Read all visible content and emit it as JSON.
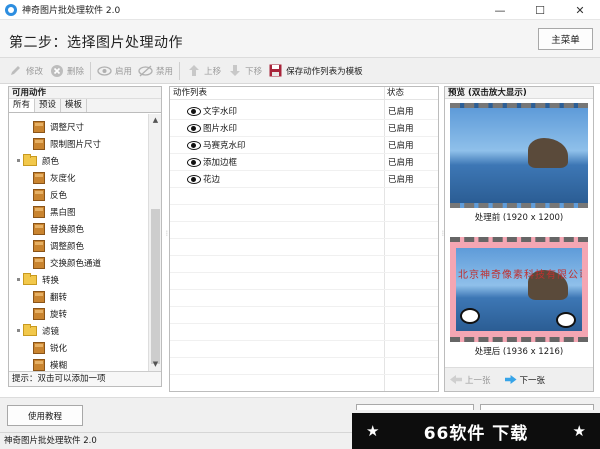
{
  "window": {
    "title": "神奇图片批处理软件 2.0"
  },
  "header": {
    "step_title": "第二步：选择图片处理动作",
    "menu_button": "主菜单"
  },
  "toolbar": {
    "modify": "修改",
    "delete": "删除",
    "enable": "启用",
    "disable": "禁用",
    "move_up": "上移",
    "move_down": "下移",
    "save_template": "保存动作列表为模板"
  },
  "left_panel": {
    "title": "可用动作",
    "tabs": [
      "所有",
      "预设",
      "模板"
    ],
    "tree": [
      {
        "label": "调整尺寸",
        "level": 2,
        "kind": "action"
      },
      {
        "label": "限制图片尺寸",
        "level": 2,
        "kind": "action"
      },
      {
        "label": "颜色",
        "level": 1,
        "kind": "folder"
      },
      {
        "label": "灰度化",
        "level": 2,
        "kind": "action"
      },
      {
        "label": "反色",
        "level": 2,
        "kind": "action"
      },
      {
        "label": "黑白图",
        "level": 2,
        "kind": "action"
      },
      {
        "label": "替换颜色",
        "level": 2,
        "kind": "action"
      },
      {
        "label": "调整颜色",
        "level": 2,
        "kind": "action"
      },
      {
        "label": "交换颜色通道",
        "level": 2,
        "kind": "action"
      },
      {
        "label": "转换",
        "level": 1,
        "kind": "folder"
      },
      {
        "label": "翻转",
        "level": 2,
        "kind": "action"
      },
      {
        "label": "旋转",
        "level": 2,
        "kind": "action"
      },
      {
        "label": "滤镜",
        "level": 1,
        "kind": "folder"
      },
      {
        "label": "锐化",
        "level": 2,
        "kind": "action"
      },
      {
        "label": "模糊",
        "level": 2,
        "kind": "action"
      }
    ],
    "hint": "提示：双击可以添加一项"
  },
  "action_list": {
    "col_action": "动作列表",
    "col_status": "状态",
    "rows": [
      {
        "name": "文字水印",
        "status": "已启用"
      },
      {
        "name": "图片水印",
        "status": "已启用"
      },
      {
        "name": "马赛克水印",
        "status": "已启用"
      },
      {
        "name": "添加边框",
        "status": "已启用"
      },
      {
        "name": "花边",
        "status": "已启用"
      }
    ]
  },
  "preview": {
    "title": "预览 (双击放大显示)",
    "before_caption": "处理前 (1920 x 1200)",
    "after_caption": "处理后 (1936 x 1216)",
    "watermark_text": "北京神奇像素科技有限公司",
    "prev": "上一张",
    "next": "下一张"
  },
  "footer": {
    "tutorial": "使用教程",
    "status": "神奇图片批处理软件 2.0"
  },
  "banner": {
    "text": "66软件 下载",
    "star": "★"
  }
}
